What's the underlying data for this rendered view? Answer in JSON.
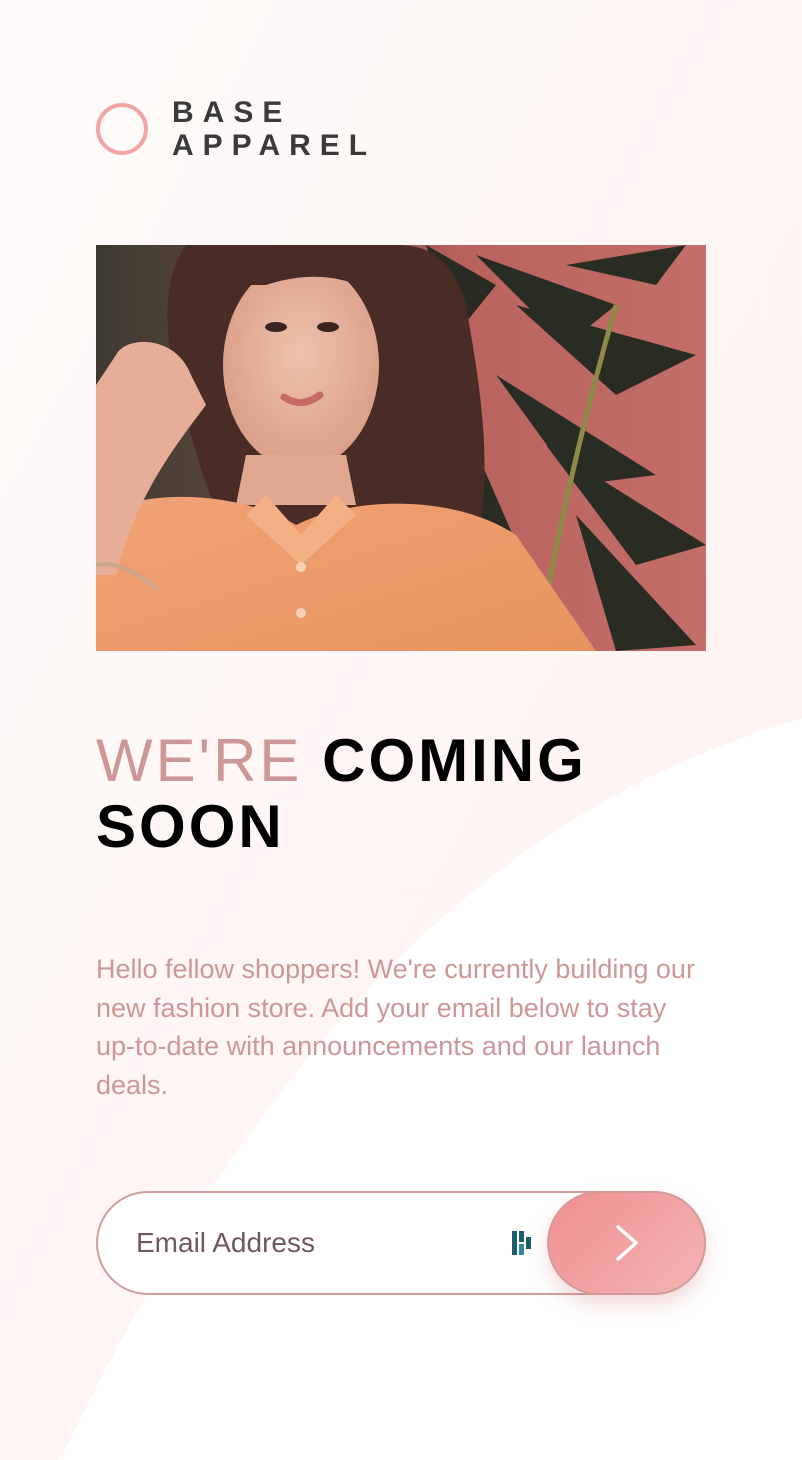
{
  "brand": {
    "line1": "BASE",
    "line2": "APPAREL",
    "accent_color": "#f2a5a5"
  },
  "hero": {
    "description": "Woman with wavy brown hair in a peach button-up shirt posing in front of a dusty pink wall with dark green plant leaves"
  },
  "headline": {
    "light": "WE'RE",
    "bold_line1": "COMING",
    "bold_line2": "SOON"
  },
  "description": "Hello fellow shoppers! We're currently building our new fashion store. Add your email below to stay up-to-date with announcements and our launch deals.",
  "form": {
    "email_placeholder": "Email Address",
    "email_value": "",
    "submit_icon": "chevron-right-icon",
    "autofill_icon": "password-manager-icon"
  },
  "colors": {
    "desaturated_red": "#ce9797",
    "dark_grayish_red": "#423a3a",
    "gradient_start": "#ef8f8f",
    "gradient_end": "#f4b4b4",
    "background_tint": "#fdf3f2"
  }
}
